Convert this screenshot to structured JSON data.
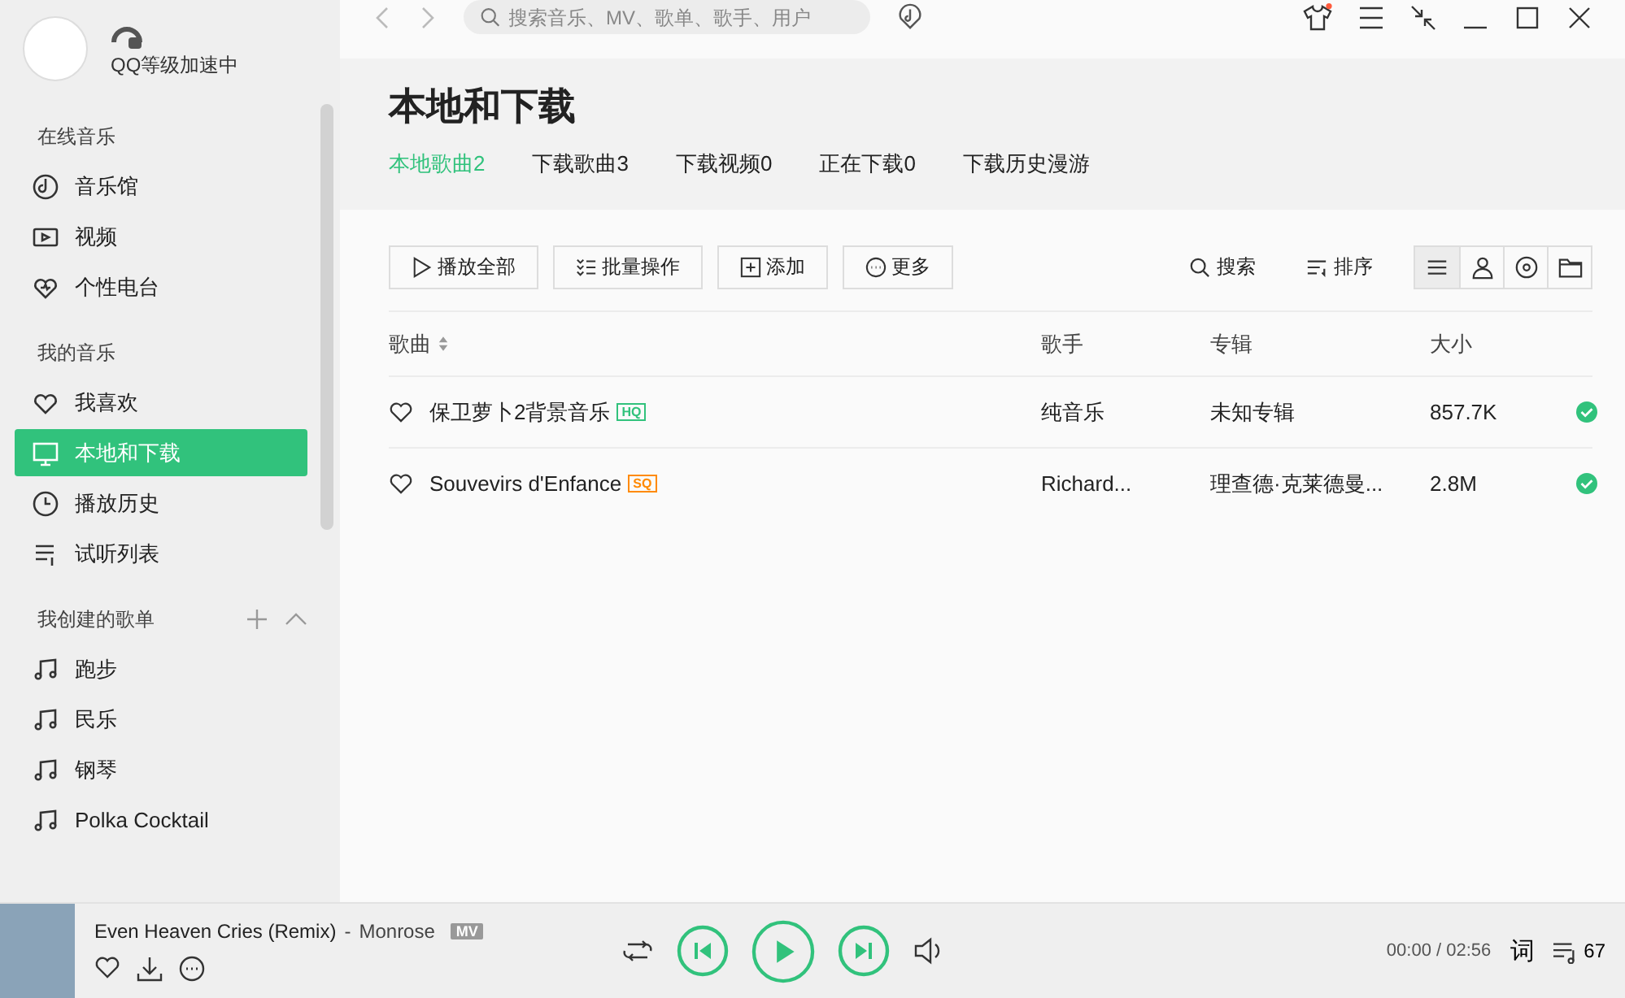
{
  "user": {
    "status": "QQ等级加速中"
  },
  "search": {
    "placeholder": "搜索音乐、MV、歌单、歌手、用户"
  },
  "sidebar": {
    "sections": [
      {
        "title": "在线音乐",
        "items": [
          {
            "label": "音乐馆",
            "selected": false
          },
          {
            "label": "视频",
            "selected": false
          },
          {
            "label": "个性电台",
            "selected": false
          }
        ]
      },
      {
        "title": "我的音乐",
        "items": [
          {
            "label": "我喜欢",
            "selected": false
          },
          {
            "label": "本地和下载",
            "selected": true
          },
          {
            "label": "播放历史",
            "selected": false
          },
          {
            "label": "试听列表",
            "selected": false
          }
        ]
      },
      {
        "title": "我创建的歌单",
        "items": [
          {
            "label": "跑步",
            "selected": false
          },
          {
            "label": "民乐",
            "selected": false
          },
          {
            "label": "钢琴",
            "selected": false
          },
          {
            "label": "Polka Cocktail",
            "selected": false
          }
        ]
      }
    ]
  },
  "page": {
    "title": "本地和下载",
    "tabs": [
      {
        "label": "本地歌曲2",
        "selected": true
      },
      {
        "label": "下载歌曲3",
        "selected": false
      },
      {
        "label": "下载视频0",
        "selected": false
      },
      {
        "label": "正在下载0",
        "selected": false
      },
      {
        "label": "下载历史漫游",
        "selected": false
      }
    ],
    "actions": [
      "播放全部",
      "批量操作",
      "添加",
      "更多"
    ],
    "tools": [
      "搜索",
      "排序"
    ],
    "views": [
      {
        "selected": true
      },
      {
        "selected": false
      },
      {
        "selected": false
      },
      {
        "selected": false
      }
    ],
    "table": {
      "columns": [
        "歌曲",
        "歌手",
        "专辑",
        "大小"
      ],
      "rows": [
        {
          "title": "保卫萝卜2背景音乐",
          "quality": "HQ",
          "color": "#31c27c",
          "artist": "纯音乐",
          "album": "未知专辑",
          "size": "857.7K",
          "downloaded": true
        },
        {
          "title": "Souvevirs d'Enfance",
          "quality": "SQ",
          "color": "#ff8a00",
          "artist": "Richard...",
          "album": "理查德·克莱德曼...",
          "size": "2.8M",
          "downloaded": true
        }
      ]
    }
  },
  "player": {
    "song": "Even Heaven Cries (Remix)",
    "separator": "-",
    "artist": "Monrose",
    "mv": "MV",
    "time": "00:00 / 02:56",
    "lyrics": "词",
    "playlist_count": "67"
  }
}
